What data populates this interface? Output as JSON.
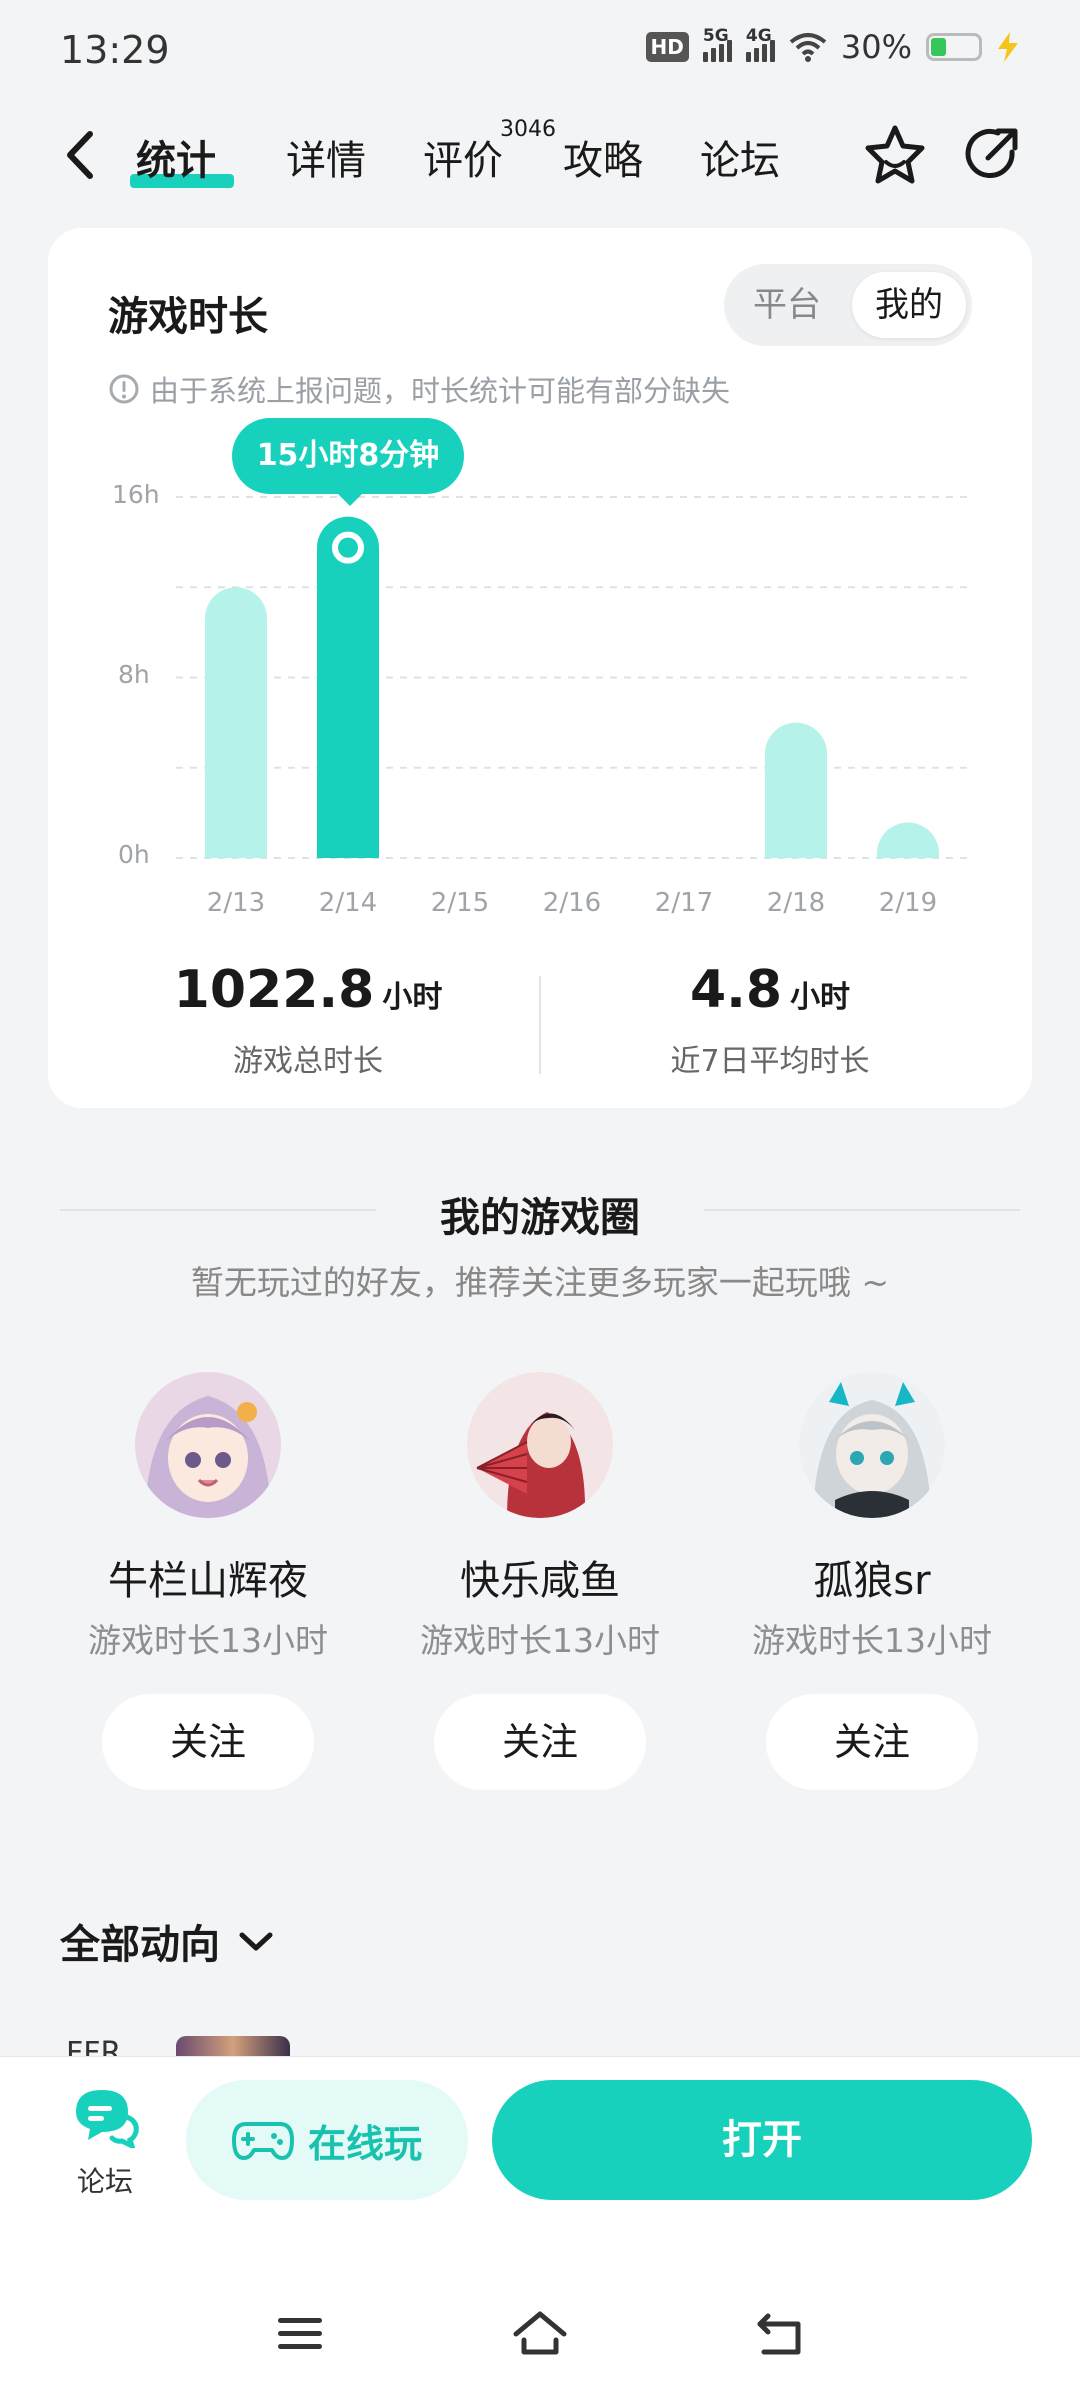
{
  "status_bar": {
    "time": "13:29",
    "hd": "HD",
    "net1": "5G",
    "net2": "4G",
    "battery": "30%"
  },
  "header": {
    "tabs": [
      {
        "label": "统计",
        "active": true
      },
      {
        "label": "详情"
      },
      {
        "label": "评价"
      },
      {
        "label": "攻略"
      },
      {
        "label": "论坛"
      }
    ],
    "review_count": "3046"
  },
  "playtime_card": {
    "title": "游戏时长",
    "toggle": {
      "platform": "平台",
      "mine": "我的",
      "selected": "我的"
    },
    "notice": "由于系统上报问题，时长统计可能有部分缺失",
    "tooltip": "15小时8分钟",
    "total": {
      "value": "1022.8",
      "unit": "小时",
      "label": "游戏总时长"
    },
    "average": {
      "value": "4.8",
      "unit": "小时",
      "label": "近7日平均时长"
    }
  },
  "chart_data": {
    "type": "bar",
    "categories": [
      "2/13",
      "2/14",
      "2/15",
      "2/16",
      "2/17",
      "2/18",
      "2/19"
    ],
    "values": [
      12.0,
      15.13,
      0,
      0,
      0,
      6.0,
      0.4
    ],
    "highlighted_index": 1,
    "y_ticks": [
      "16h",
      "8h",
      "0h"
    ],
    "ylim": [
      0,
      16
    ],
    "grid": true,
    "colors": {
      "bar": "#b4f2ea",
      "highlight": "#18d1bd"
    }
  },
  "game_circle": {
    "title": "我的游戏圈",
    "subtitle": "暂无玩过的好友，推荐关注更多玩家一起玩哦 ~",
    "friends": [
      {
        "name": "牛栏山辉夜",
        "time": "游戏时长13小时",
        "follow": "关注"
      },
      {
        "name": "快乐咸鱼",
        "time": "游戏时长13小时",
        "follow": "关注"
      },
      {
        "name": "孤狼sr",
        "time": "游戏时长13小时",
        "follow": "关注"
      }
    ]
  },
  "feed": {
    "title": "全部动向",
    "peek": "FFR"
  },
  "bottom_bar": {
    "forum": "论坛",
    "play_online": "在线玩",
    "open": "打开"
  },
  "colors": {
    "accent": "#18d1bd",
    "accent_light": "#b4f2ea"
  }
}
